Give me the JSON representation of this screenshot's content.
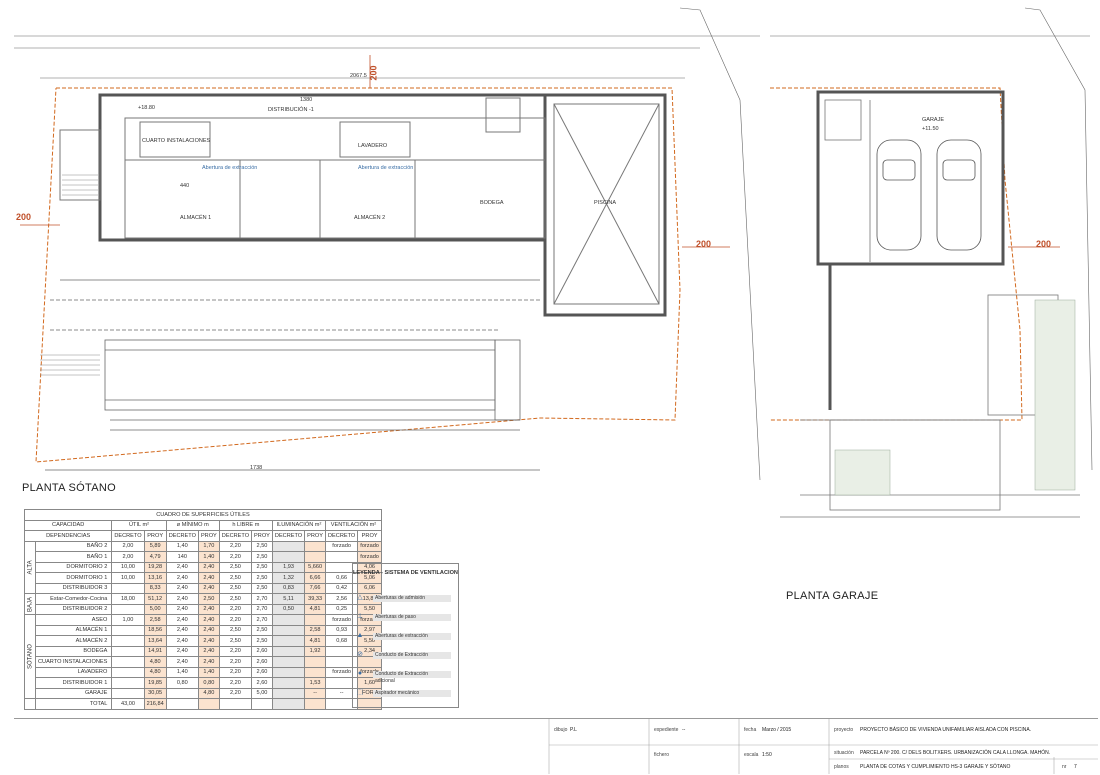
{
  "plan_labels": {
    "planta_sotano": "PLANTA SÓTANO",
    "planta_garaje": "PLANTA GARAJE",
    "dim_200": "200",
    "cuarto_instalaciones": "CUARTO INSTALACIONES",
    "lavadero": "LAVADERO",
    "distribucion": "DISTRIBUCIÓN -1",
    "almacen1": "ALMACÉN 1",
    "almacen2": "ALMACÉN 2",
    "bodega": "BODEGA",
    "piscina": "PISCINA",
    "garaje": "GARAJE",
    "cota_sotano": "+18.80",
    "cota_garaje": "+11.50",
    "abertura_extraccion": "Abertura de extracción",
    "total_width": "2067.5",
    "bottom_width": "1738",
    "dim_1380": "1380",
    "dim_440": "440"
  },
  "table": {
    "title": "CUADRO DE SUPERFICIES ÚTILES",
    "headers": [
      "CAPACIDAD",
      "ÚTIL m²",
      "ø MÍNIMO m",
      "h LIBRE m",
      "ILUMINACIÓN m²",
      "VENTILACIÓN m²"
    ],
    "subheaders": [
      "DEPENDENCIAS",
      "DECRETO",
      "PROY",
      "DECRETO",
      "PROY",
      "DECRETO",
      "PROY",
      "DECRETO",
      "PROY",
      "DECRETO",
      "PROY"
    ],
    "groups": {
      "alta": "ALTA",
      "baja": "BAJA",
      "sotano": "SÓTANO"
    },
    "rows": [
      [
        "BAÑO 2",
        "2,00",
        "5,89",
        "1,40",
        "1,70",
        "2,20",
        "2,50",
        "",
        "",
        "forzado",
        "forzado"
      ],
      [
        "BAÑO 1",
        "2,00",
        "4,79",
        "140",
        "1,40",
        "2,20",
        "2,50",
        "",
        "",
        "",
        "forzado"
      ],
      [
        "DORMITORIO 2",
        "10,00",
        "19,28",
        "2,40",
        "2,40",
        "2,50",
        "2,50",
        "1,93",
        "5,660",
        "",
        "4,06"
      ],
      [
        "DORMITORIO 1",
        "10,00",
        "13,16",
        "2,40",
        "2,40",
        "2,50",
        "2,50",
        "1,32",
        "6,66",
        "0,66",
        "5,06"
      ],
      [
        "DISTRIBUIDOR 3",
        "",
        "8,33",
        "2,40",
        "2,40",
        "2,50",
        "2,50",
        "0,83",
        "7,66",
        "0,42",
        "6,06"
      ],
      [
        "Estar-Comedor-Cocina",
        "18,00",
        "51,12",
        "2,40",
        "2,50",
        "2,50",
        "2,70",
        "5,11",
        "39,33",
        "2,56",
        "13,82"
      ],
      [
        "DISTRIBUIDOR 2",
        "",
        "5,00",
        "2,40",
        "2,40",
        "2,20",
        "2,70",
        "0,50",
        "4,81",
        "0,25",
        "5,50"
      ],
      [
        "ASEO",
        "1,00",
        "2,58",
        "2,40",
        "2,40",
        "2,20",
        "2,70",
        "",
        "",
        "forzado",
        "forzado"
      ],
      [
        "ALMACÉN 1",
        "",
        "18,56",
        "2,40",
        "2,40",
        "2,50",
        "2,50",
        "",
        "2,58",
        "0,93",
        "2,97"
      ],
      [
        "ALMACÉN 2",
        "",
        "13,64",
        "2,40",
        "2,40",
        "2,50",
        "2,50",
        "",
        "4,81",
        "0,68",
        "5,50"
      ],
      [
        "BODEGA",
        "",
        "14,91",
        "2,40",
        "2,40",
        "2,20",
        "2,60",
        "",
        "1,92",
        "",
        "2,34"
      ],
      [
        "CUARTO INSTALACIONES",
        "",
        "4,80",
        "2,40",
        "2,40",
        "2,20",
        "2,60",
        "",
        "",
        "",
        ""
      ],
      [
        "LAVADERO",
        "",
        "4,80",
        "1,40",
        "1,40",
        "2,20",
        "2,60",
        "",
        "",
        "forzado",
        "forzado"
      ],
      [
        "DISTRIBUIDOR 1",
        "",
        "19,85",
        "0,80",
        "0,80",
        "2,20",
        "2,60",
        "",
        "1,53",
        "",
        "1,60"
      ],
      [
        "GARAJE",
        "",
        "30,05",
        "",
        "4,80",
        "2,20",
        "5,00",
        "",
        "--",
        "--",
        "FORZ"
      ],
      [
        "TOTAL",
        "43,00",
        "216,84",
        "",
        "",
        "",
        "",
        "",
        "",
        "",
        ""
      ]
    ]
  },
  "legend": {
    "title": "LEYENDA - SISTEMA DE VENTILACION",
    "items": [
      {
        "icon": "open-triangle-arrow-icon",
        "label": "Aberturas de admisión"
      },
      {
        "icon": "dashed-triangle-arrow-icon",
        "label": "Aberturas de paso"
      },
      {
        "icon": "filled-triangle-icon",
        "label": "Aberturas de extracción"
      },
      {
        "icon": "circle-slash-icon",
        "label": "Conducto de Extracción"
      },
      {
        "icon": "filled-dot-icon",
        "label": "Conducto de Extracción adicional"
      },
      {
        "icon": "dashed-square-icon",
        "label": "Aspirador mecánico"
      }
    ]
  },
  "title_block": {
    "dibujo_label": "dibujo",
    "dibujo_value": "P.L",
    "expediente_label": "expediente",
    "expediente_value": "--",
    "fecha_label": "fecha",
    "fecha_value": "Marzo / 2015",
    "proyecto_label": "proyecto",
    "proyecto_value": "PROYECTO BÁSICO DE VIVIENDA UNIFAMILIAR AISLADA CON PISCINA.",
    "fichero_label": "fichero",
    "escala_label": "escala",
    "escala_value": "1:50",
    "situacion_label": "situación",
    "situacion_value": "PARCELA Nº 200. C/ DELS BOLITXERS. URBANIZACIÓN CALA LLONGA. MAHÓN.",
    "planos_label": "planos",
    "planos_value": "PLANTA DE COTAS Y CUMPLIMIENTO HS-3 GARAJE  Y SÓTANO",
    "nr_label": "nr",
    "nr_value": "7"
  },
  "colors": {
    "plot_boundary": "#d2691e",
    "dim_red": "#c0502a",
    "highlight": "#fbe3cf",
    "grey": "#e6e6e6"
  }
}
